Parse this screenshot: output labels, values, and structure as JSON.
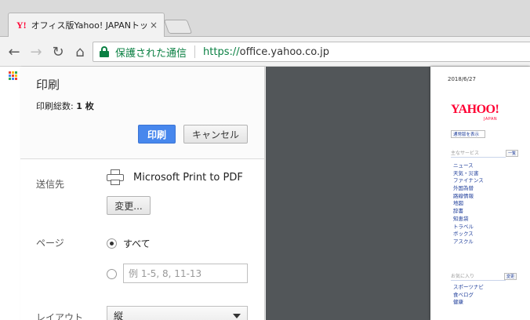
{
  "browser": {
    "tab": {
      "favicon": "Y!",
      "title": "オフィス版Yahoo! JAPANトップ",
      "close": "×"
    },
    "toolbar": {
      "back": "←",
      "forward": "→",
      "reload": "↻",
      "home": "⌂"
    },
    "omnibox": {
      "secure_label": "保護された通信",
      "url_scheme": "https://",
      "url_host": "office.yahoo.co.jp"
    },
    "apps_colors": [
      "#ea4335",
      "#fbbc05",
      "#34a853",
      "#4285f4",
      "#ea4335",
      "#fbbc05",
      "#34a853",
      "#4285f4",
      "#ea4335"
    ]
  },
  "print_dialog": {
    "title": "印刷",
    "sheet_count_label": "印刷総数:",
    "sheet_count_value": "1 枚",
    "print_button": "印刷",
    "cancel_button": "キャンセル",
    "destination": {
      "label": "送信先",
      "name": "Microsoft Print to PDF",
      "change_button": "変更..."
    },
    "pages": {
      "label": "ページ",
      "all_label": "すべて",
      "custom_placeholder": "例 1-5, 8, 11-13",
      "selected": "all"
    },
    "layout": {
      "label": "レイアウト",
      "value": "縦"
    },
    "accent_color": "#4787ed"
  },
  "preview": {
    "date": "2018/6/27",
    "logo": "YAHOO!",
    "logo_sub": "JAPAN",
    "standard_link": "通常版を表示",
    "main_services_heading": "主なサービス",
    "main_services_button": "一覧",
    "services": [
      "ニュース",
      "天気・災害",
      "ファイナンス",
      "外国為替",
      "路線情報",
      "地図",
      "辞書",
      "知恵袋",
      "トラベル",
      "ボックス",
      "アスクル"
    ],
    "favorites_heading": "お気に入り",
    "favorites_button": "変更",
    "favorites": [
      "スポーツナビ",
      "食べログ",
      "健康"
    ]
  }
}
